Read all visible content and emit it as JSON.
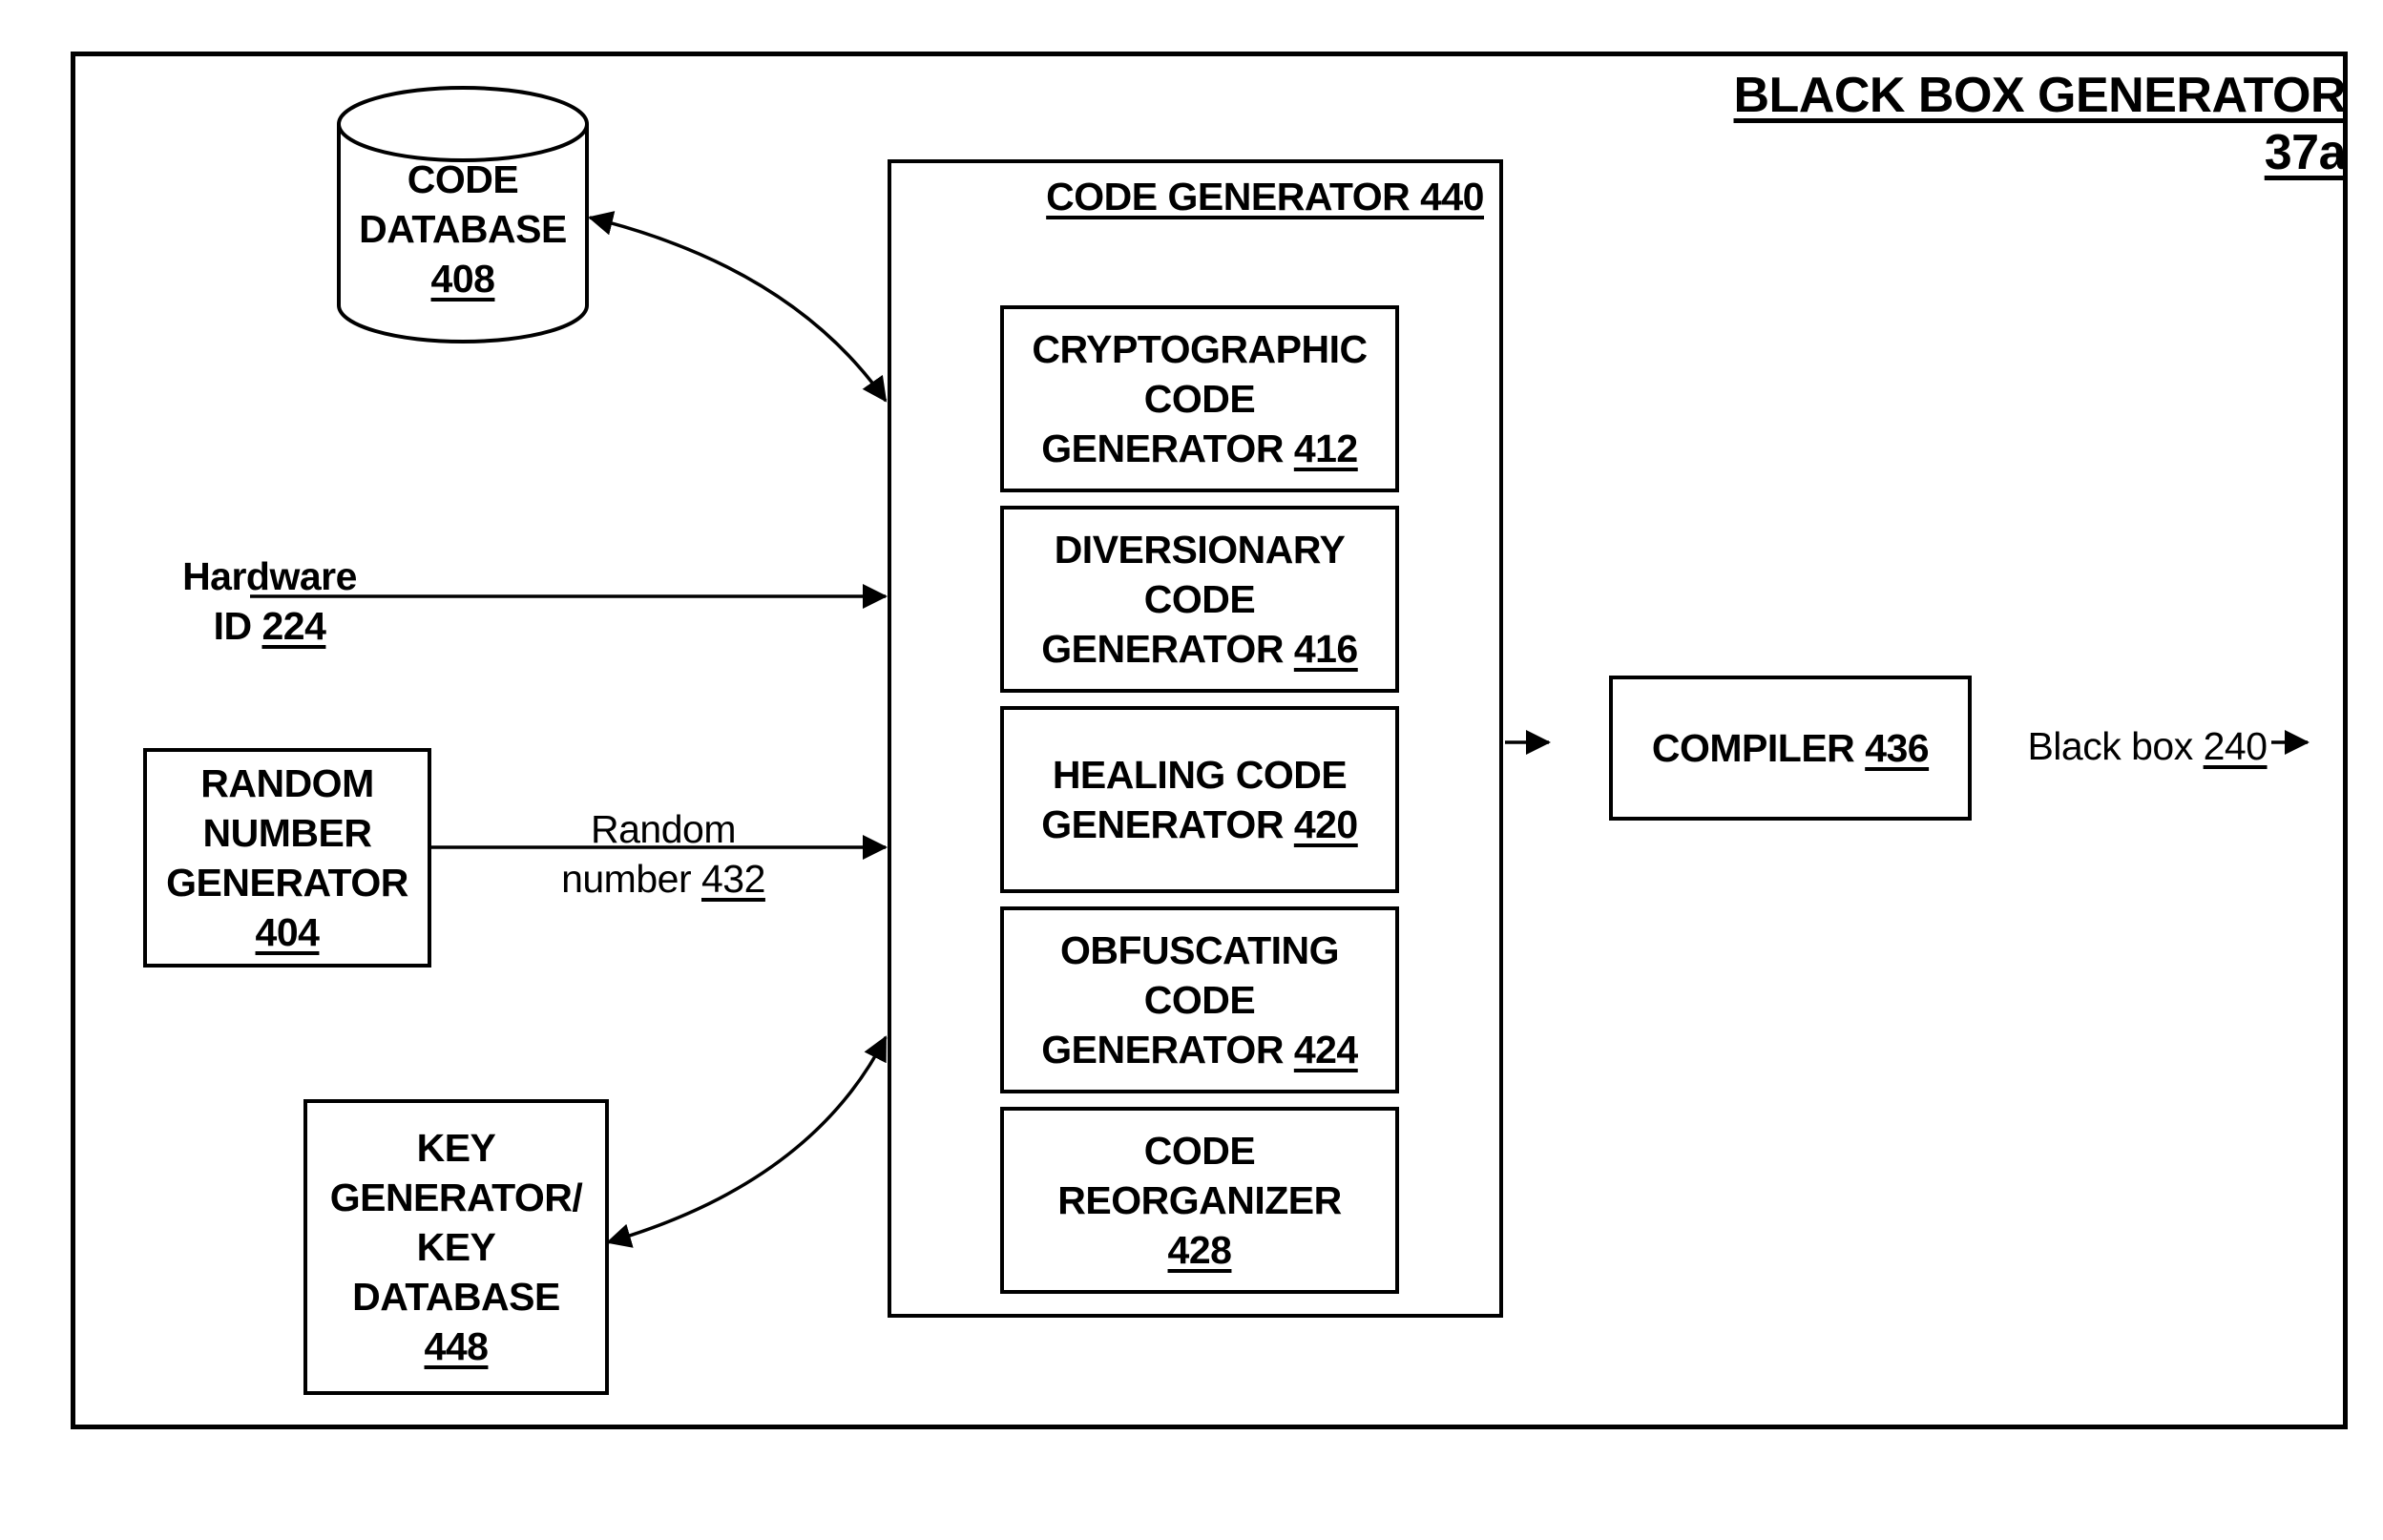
{
  "diagram": {
    "title": "BLACK BOX GENERATOR 37a",
    "code_database": {
      "lines": [
        "CODE",
        "DATABASE"
      ],
      "ref": "408"
    },
    "code_generator": {
      "title": "CODE GENERATOR 440"
    },
    "sub_generators": [
      {
        "lines": [
          "CRYPTOGRAPHIC",
          "CODE"
        ],
        "last": "GENERATOR ",
        "ref": "412"
      },
      {
        "lines": [
          "DIVERSIONARY",
          "CODE"
        ],
        "last": "GENERATOR ",
        "ref": "416"
      },
      {
        "lines": [
          "HEALING CODE"
        ],
        "last": "GENERATOR ",
        "ref": "420"
      },
      {
        "lines": [
          "OBFUSCATING",
          "CODE"
        ],
        "last": "GENERATOR ",
        "ref": "424"
      },
      {
        "lines": [
          "CODE",
          "REORGANIZER"
        ],
        "last": "",
        "ref": "428"
      }
    ],
    "hardware_id": {
      "line1": "Hardware",
      "prefix": "ID ",
      "ref": "224"
    },
    "random_number_generator": {
      "lines": [
        "RANDOM",
        "NUMBER",
        "GENERATOR"
      ],
      "ref": "404"
    },
    "random_number_label": {
      "line1": "Random",
      "prefix": "number ",
      "ref": "432"
    },
    "key_generator": {
      "lines": [
        "KEY",
        "GENERATOR/",
        "KEY",
        "DATABASE"
      ],
      "ref": "448"
    },
    "compiler": {
      "label": "COMPILER ",
      "ref": "436"
    },
    "output": {
      "prefix": "Black box ",
      "ref": "240"
    }
  }
}
